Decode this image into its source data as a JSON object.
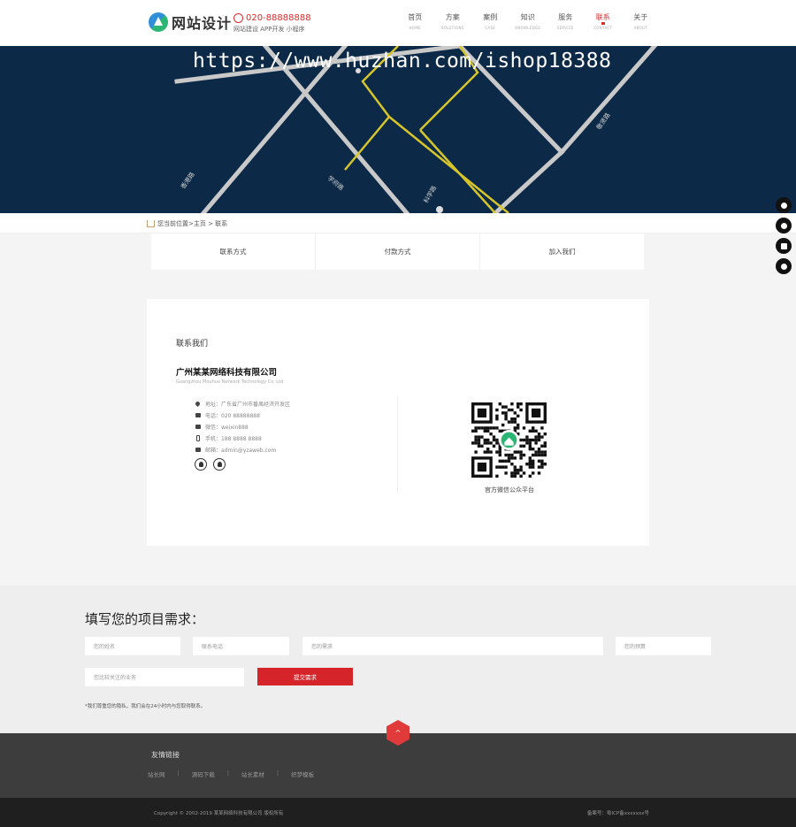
{
  "header": {
    "logo_text": "网站设计",
    "phone": "020-88888888",
    "phone_sub": "网站建设 APP开发 小程序"
  },
  "nav": [
    {
      "label": "首页",
      "en": "HOME",
      "active": false
    },
    {
      "label": "方案",
      "en": "SOLUTIONS",
      "active": false
    },
    {
      "label": "案例",
      "en": "CASE",
      "active": false
    },
    {
      "label": "知识",
      "en": "KNOWLEDGE",
      "active": false
    },
    {
      "label": "服务",
      "en": "SERVICE",
      "active": false
    },
    {
      "label": "联系",
      "en": "CONTACT",
      "active": true
    },
    {
      "label": "关于",
      "en": "ABOUT",
      "active": false
    }
  ],
  "banner": {
    "watermark": "https://www.huzhan.com/ishop18388"
  },
  "breadcrumb": "您当前位置>主页 > 联系",
  "tabs": [
    "联系方式",
    "付款方式",
    "加入我们"
  ],
  "contact": {
    "title": "联系我们",
    "company": "广州某某网络科技有限公司",
    "company_en": "Guangzhou Mouhuo Network Technology Co. Ltd",
    "rows": [
      {
        "icon": "location-icon",
        "text": "地址：广东省广州市番禺经济开发区"
      },
      {
        "icon": "phone-icon",
        "text": "电话：020 88888888"
      },
      {
        "icon": "wechat-icon",
        "text": "微信：weixin888"
      },
      {
        "icon": "mobile-icon",
        "text": "手机：188 8888 8888"
      },
      {
        "icon": "email-icon",
        "text": "邮箱：admin@yzaweb.com"
      }
    ],
    "qr_caption": "官方微信公众平台"
  },
  "form": {
    "title": "填写您的项目需求：",
    "name_placeholder": "您的姓名",
    "phone_placeholder": "联系电话",
    "need_placeholder": "您的需求",
    "budget_placeholder": "您的预算",
    "concern_placeholder": "您比较关注的业务",
    "submit_label": "提交需求",
    "note": "*我们尊重您的隐私，我们会在24小时内与您取得联系。"
  },
  "footer": {
    "top_arrow": "^",
    "links_title": "友情链接",
    "links": [
      "站长网",
      "源码下载",
      "站长素材",
      "织梦模板"
    ],
    "copyright": "Copyright © 2002-2019 某某网络科技有限公司 版权所有",
    "icp": "备案号：粤ICP备xxxxxxx号"
  },
  "colors": {
    "accent": "#d5252b",
    "map_bg": "#0c2a47",
    "road": "#c9c9c9",
    "route": "#d6c52a"
  }
}
